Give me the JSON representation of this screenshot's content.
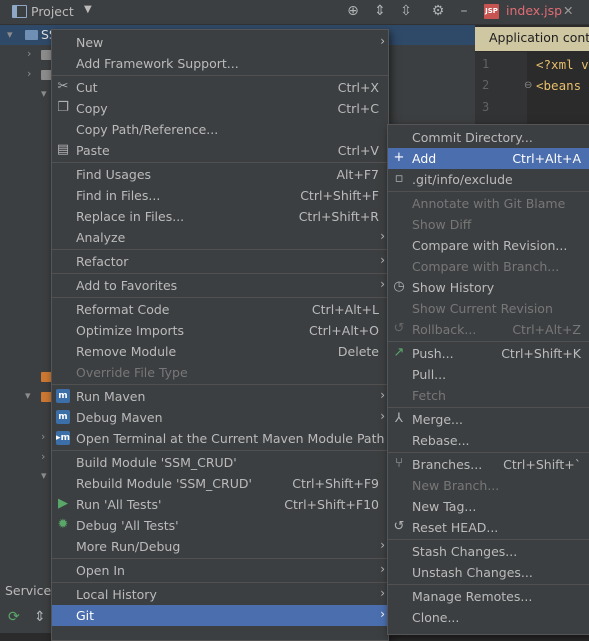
{
  "project": {
    "title": "Project",
    "root_label": "SS"
  },
  "editor": {
    "tab": "index.jsp",
    "notification": "Application conte",
    "lines": [
      {
        "num": "1",
        "code": "<?xml v"
      },
      {
        "num": "2",
        "code": "<beans"
      },
      {
        "num": "3",
        "code": ""
      }
    ]
  },
  "services": {
    "label": "Services"
  },
  "context_menu": {
    "items": [
      {
        "label": "New",
        "submenu": true
      },
      {
        "label": "Add Framework Support..."
      },
      {
        "label": "Cut",
        "shortcut": "Ctrl+X",
        "icon": "scissors-icon"
      },
      {
        "label": "Copy",
        "shortcut": "Ctrl+C",
        "icon": "copy-icon"
      },
      {
        "label": "Copy Path/Reference..."
      },
      {
        "label": "Paste",
        "shortcut": "Ctrl+V",
        "icon": "paste-icon"
      },
      {
        "label": "Find Usages",
        "shortcut": "Alt+F7"
      },
      {
        "label": "Find in Files...",
        "shortcut": "Ctrl+Shift+F"
      },
      {
        "label": "Replace in Files...",
        "shortcut": "Ctrl+Shift+R"
      },
      {
        "label": "Analyze",
        "submenu": true
      },
      {
        "label": "Refactor",
        "submenu": true
      },
      {
        "label": "Add to Favorites",
        "submenu": true
      },
      {
        "label": "Reformat Code",
        "shortcut": "Ctrl+Alt+L"
      },
      {
        "label": "Optimize Imports",
        "shortcut": "Ctrl+Alt+O"
      },
      {
        "label": "Remove Module",
        "shortcut": "Delete"
      },
      {
        "label": "Override File Type",
        "disabled": true
      },
      {
        "label": "Run Maven",
        "submenu": true,
        "icon": "maven-icon"
      },
      {
        "label": "Debug Maven",
        "submenu": true,
        "icon": "maven-icon"
      },
      {
        "label": "Open Terminal at the Current Maven Module Path",
        "icon": "maven-terminal-icon"
      },
      {
        "label": "Build Module 'SSM_CRUD'"
      },
      {
        "label": "Rebuild Module 'SSM_CRUD'",
        "shortcut": "Ctrl+Shift+F9"
      },
      {
        "label": "Run 'All Tests'",
        "shortcut": "Ctrl+Shift+F10",
        "icon": "run-icon"
      },
      {
        "label": "Debug 'All Tests'",
        "icon": "debug-icon"
      },
      {
        "label": "More Run/Debug",
        "submenu": true
      },
      {
        "label": "Open In",
        "submenu": true
      },
      {
        "label": "Local History",
        "submenu": true
      },
      {
        "label": "Git",
        "submenu": true,
        "selected": true
      }
    ]
  },
  "git_menu": {
    "items": [
      {
        "label": "Commit Directory..."
      },
      {
        "label": "Add",
        "shortcut": "Ctrl+Alt+A",
        "icon": "plus-icon",
        "selected": true
      },
      {
        "label": ".git/info/exclude",
        "icon": "file-icon"
      },
      {
        "label": "Annotate with Git Blame",
        "disabled": true
      },
      {
        "label": "Show Diff",
        "disabled": true
      },
      {
        "label": "Compare with Revision..."
      },
      {
        "label": "Compare with Branch...",
        "disabled": true
      },
      {
        "label": "Show History",
        "icon": "clock-icon"
      },
      {
        "label": "Show Current Revision",
        "disabled": true
      },
      {
        "label": "Rollback...",
        "shortcut": "Ctrl+Alt+Z",
        "disabled": true,
        "icon": "undo-icon"
      },
      {
        "label": "Push...",
        "shortcut": "Ctrl+Shift+K",
        "icon": "push-arrow-icon"
      },
      {
        "label": "Pull..."
      },
      {
        "label": "Fetch",
        "disabled": true
      },
      {
        "label": "Merge...",
        "icon": "merge-icon"
      },
      {
        "label": "Rebase..."
      },
      {
        "label": "Branches...",
        "shortcut": "Ctrl+Shift+`",
        "icon": "branch-icon"
      },
      {
        "label": "New Branch...",
        "disabled": true
      },
      {
        "label": "New Tag..."
      },
      {
        "label": "Reset HEAD...",
        "icon": "undo-icon"
      },
      {
        "label": "Stash Changes..."
      },
      {
        "label": "Unstash Changes..."
      },
      {
        "label": "Manage Remotes..."
      },
      {
        "label": "Clone..."
      }
    ]
  }
}
